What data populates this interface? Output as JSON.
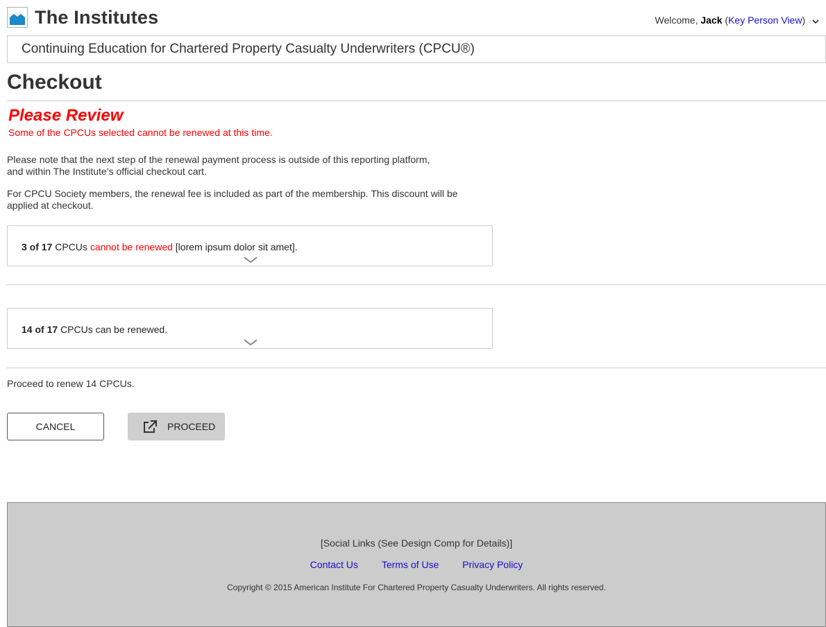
{
  "header": {
    "brand": "The Institutes",
    "welcome_prefix": "Welcome, ",
    "user_name": "Jack",
    "paren_open": "(",
    "view_link": "Key Person View",
    "paren_close": ")"
  },
  "program": {
    "title": "Continuing Education for Chartered Property Casualty Underwriters (CPCU®)"
  },
  "page": {
    "title": "Checkout"
  },
  "review": {
    "title": "Please Review",
    "subtitle": "Some of the CPCUs selected cannot be renewed at this time."
  },
  "notes": {
    "line1": "Please note that the next step of the renewal payment process is outside of this reporting platform,",
    "line2": "and within The Institute’s official checkout cart.",
    "line3": "For CPCU Society members, the renewal fee is included as part of the membership. This discount will be",
    "line4": "applied at checkout."
  },
  "panels": [
    {
      "count": "3 of 17",
      "text_a": " CPCUs ",
      "status": "cannot be renewed",
      "text_b": " [lorem ipsum dolor sit amet]."
    },
    {
      "count": "14 of 17",
      "text_a": " CPCUs can be renewed.",
      "status": "",
      "text_b": ""
    }
  ],
  "proceed_note": "Proceed to renew 14 CPCUs.",
  "buttons": {
    "cancel": "CANCEL",
    "proceed": "PROCEED"
  },
  "footer": {
    "social": "[Social Links (See Design Comp for Details)]",
    "links": [
      "Contact Us",
      "Terms of Use",
      "Privacy Policy"
    ],
    "copyright": "Copyright © 2015 American Institute For Chartered Property Casualty Underwriters. All rights reserved."
  },
  "colors": {
    "error": "#ff0000",
    "link": "#1a0dcc",
    "footer_bg": "#cccccc",
    "logo_accent": "#1e88c8"
  },
  "icons": {
    "logo": "image-placeholder-icon",
    "chevron": "chevron-down-icon",
    "external": "external-link-icon"
  }
}
